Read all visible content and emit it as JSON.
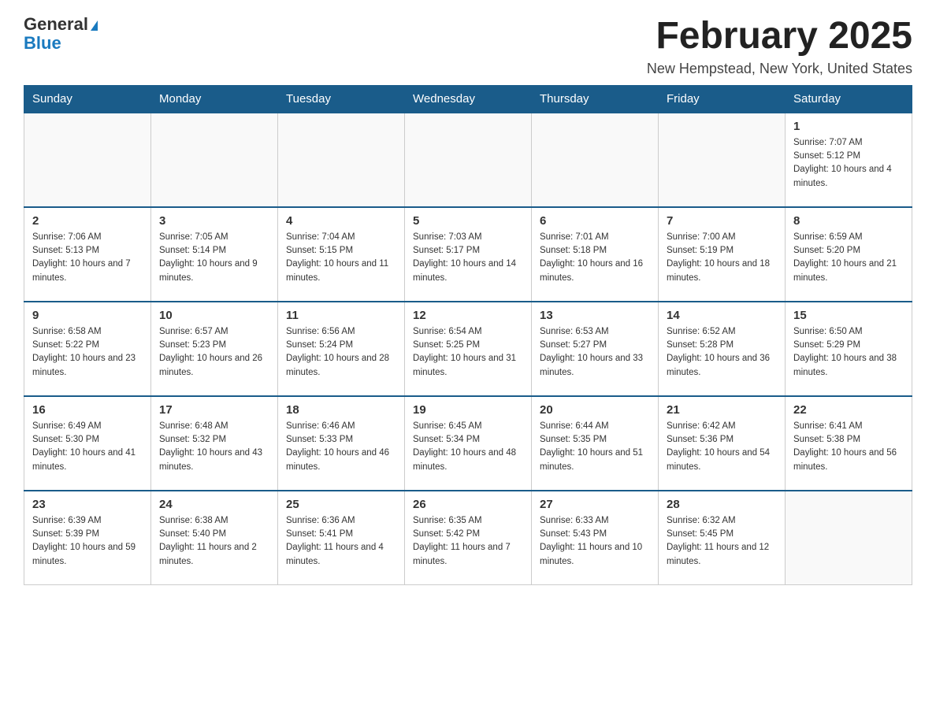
{
  "logo": {
    "general": "General",
    "blue": "Blue"
  },
  "header": {
    "title": "February 2025",
    "subtitle": "New Hempstead, New York, United States"
  },
  "days_of_week": [
    "Sunday",
    "Monday",
    "Tuesday",
    "Wednesday",
    "Thursday",
    "Friday",
    "Saturday"
  ],
  "weeks": [
    [
      {
        "day": "",
        "info": ""
      },
      {
        "day": "",
        "info": ""
      },
      {
        "day": "",
        "info": ""
      },
      {
        "day": "",
        "info": ""
      },
      {
        "day": "",
        "info": ""
      },
      {
        "day": "",
        "info": ""
      },
      {
        "day": "1",
        "info": "Sunrise: 7:07 AM\nSunset: 5:12 PM\nDaylight: 10 hours and 4 minutes."
      }
    ],
    [
      {
        "day": "2",
        "info": "Sunrise: 7:06 AM\nSunset: 5:13 PM\nDaylight: 10 hours and 7 minutes."
      },
      {
        "day": "3",
        "info": "Sunrise: 7:05 AM\nSunset: 5:14 PM\nDaylight: 10 hours and 9 minutes."
      },
      {
        "day": "4",
        "info": "Sunrise: 7:04 AM\nSunset: 5:15 PM\nDaylight: 10 hours and 11 minutes."
      },
      {
        "day": "5",
        "info": "Sunrise: 7:03 AM\nSunset: 5:17 PM\nDaylight: 10 hours and 14 minutes."
      },
      {
        "day": "6",
        "info": "Sunrise: 7:01 AM\nSunset: 5:18 PM\nDaylight: 10 hours and 16 minutes."
      },
      {
        "day": "7",
        "info": "Sunrise: 7:00 AM\nSunset: 5:19 PM\nDaylight: 10 hours and 18 minutes."
      },
      {
        "day": "8",
        "info": "Sunrise: 6:59 AM\nSunset: 5:20 PM\nDaylight: 10 hours and 21 minutes."
      }
    ],
    [
      {
        "day": "9",
        "info": "Sunrise: 6:58 AM\nSunset: 5:22 PM\nDaylight: 10 hours and 23 minutes."
      },
      {
        "day": "10",
        "info": "Sunrise: 6:57 AM\nSunset: 5:23 PM\nDaylight: 10 hours and 26 minutes."
      },
      {
        "day": "11",
        "info": "Sunrise: 6:56 AM\nSunset: 5:24 PM\nDaylight: 10 hours and 28 minutes."
      },
      {
        "day": "12",
        "info": "Sunrise: 6:54 AM\nSunset: 5:25 PM\nDaylight: 10 hours and 31 minutes."
      },
      {
        "day": "13",
        "info": "Sunrise: 6:53 AM\nSunset: 5:27 PM\nDaylight: 10 hours and 33 minutes."
      },
      {
        "day": "14",
        "info": "Sunrise: 6:52 AM\nSunset: 5:28 PM\nDaylight: 10 hours and 36 minutes."
      },
      {
        "day": "15",
        "info": "Sunrise: 6:50 AM\nSunset: 5:29 PM\nDaylight: 10 hours and 38 minutes."
      }
    ],
    [
      {
        "day": "16",
        "info": "Sunrise: 6:49 AM\nSunset: 5:30 PM\nDaylight: 10 hours and 41 minutes."
      },
      {
        "day": "17",
        "info": "Sunrise: 6:48 AM\nSunset: 5:32 PM\nDaylight: 10 hours and 43 minutes."
      },
      {
        "day": "18",
        "info": "Sunrise: 6:46 AM\nSunset: 5:33 PM\nDaylight: 10 hours and 46 minutes."
      },
      {
        "day": "19",
        "info": "Sunrise: 6:45 AM\nSunset: 5:34 PM\nDaylight: 10 hours and 48 minutes."
      },
      {
        "day": "20",
        "info": "Sunrise: 6:44 AM\nSunset: 5:35 PM\nDaylight: 10 hours and 51 minutes."
      },
      {
        "day": "21",
        "info": "Sunrise: 6:42 AM\nSunset: 5:36 PM\nDaylight: 10 hours and 54 minutes."
      },
      {
        "day": "22",
        "info": "Sunrise: 6:41 AM\nSunset: 5:38 PM\nDaylight: 10 hours and 56 minutes."
      }
    ],
    [
      {
        "day": "23",
        "info": "Sunrise: 6:39 AM\nSunset: 5:39 PM\nDaylight: 10 hours and 59 minutes."
      },
      {
        "day": "24",
        "info": "Sunrise: 6:38 AM\nSunset: 5:40 PM\nDaylight: 11 hours and 2 minutes."
      },
      {
        "day": "25",
        "info": "Sunrise: 6:36 AM\nSunset: 5:41 PM\nDaylight: 11 hours and 4 minutes."
      },
      {
        "day": "26",
        "info": "Sunrise: 6:35 AM\nSunset: 5:42 PM\nDaylight: 11 hours and 7 minutes."
      },
      {
        "day": "27",
        "info": "Sunrise: 6:33 AM\nSunset: 5:43 PM\nDaylight: 11 hours and 10 minutes."
      },
      {
        "day": "28",
        "info": "Sunrise: 6:32 AM\nSunset: 5:45 PM\nDaylight: 11 hours and 12 minutes."
      },
      {
        "day": "",
        "info": ""
      }
    ]
  ]
}
